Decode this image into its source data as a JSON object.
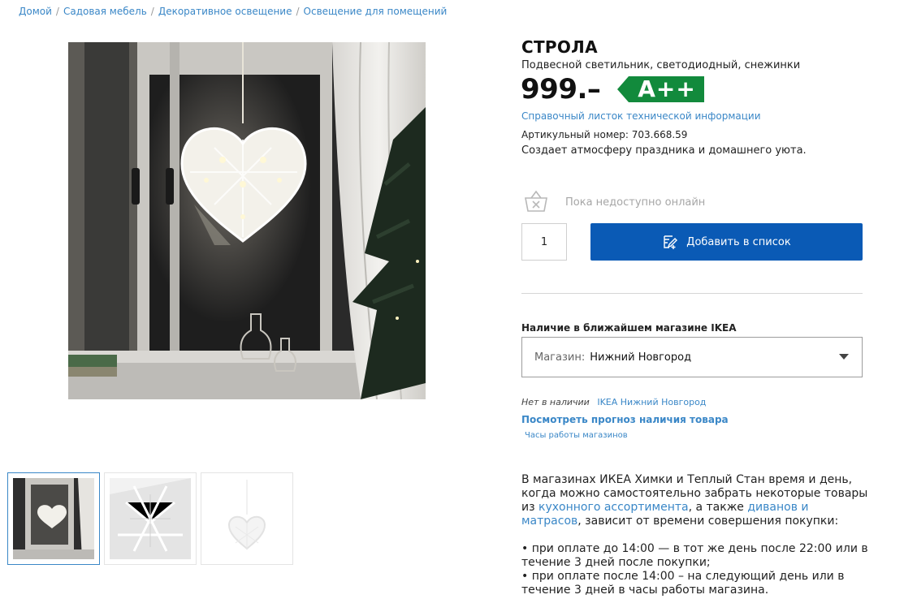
{
  "breadcrumb": {
    "items": [
      "Домой",
      "Садовая мебель",
      "Декоративное освещение",
      "Освещение для помещений"
    ],
    "separator": "/"
  },
  "product": {
    "name": "СТРОЛА",
    "description": "Подвесной светильник, светодиодный, снежинки",
    "price": "999.–",
    "energy_class": "A++",
    "energy_color": "#128a3c",
    "tech_sheet_link": "Справочный листок технической информации",
    "article": "Артикульный номер: 703.668.59",
    "tagline": "Создает атмосферу праздника и домашнего уюта."
  },
  "purchase": {
    "online_status": "Пока недоступно онлайн",
    "quantity": "1",
    "add_button_label": "Добавить в список",
    "button_color": "#0a5ab5"
  },
  "availability": {
    "title": "Наличие в ближайшем магазине IKEA",
    "store_label": "Магазин:",
    "store_value": "Нижний Новгород",
    "out_of_stock": "Нет в наличии",
    "store_link": "IKEA Нижний Новгород",
    "forecast_link": "Посмотреть прогноз наличия товара",
    "hours_link": "Часы работы магазинов"
  },
  "pickup_info": {
    "para1_before": "В магазинах ИКЕА Химки и Теплый Стан время и день, когда можно самостоятельно забрать некоторые товары из ",
    "link1": "кухонного ассортимента",
    "para1_mid": ", а также ",
    "link2": "диванов и матрасов",
    "para1_after": ", зависит от времени совершения покупки:",
    "bullet1": "• при оплате до 14:00 — в тот же день после 22:00 или в течение 3 дней после покупки;",
    "bullet2": "• при оплате после 14:00 – на следующий день или в течение 3 дней в часы работы магазина."
  },
  "images": {
    "main": "product-photo-window",
    "thumbnails": [
      "thumb-window-photo",
      "thumb-closeup",
      "thumb-product-white"
    ]
  }
}
